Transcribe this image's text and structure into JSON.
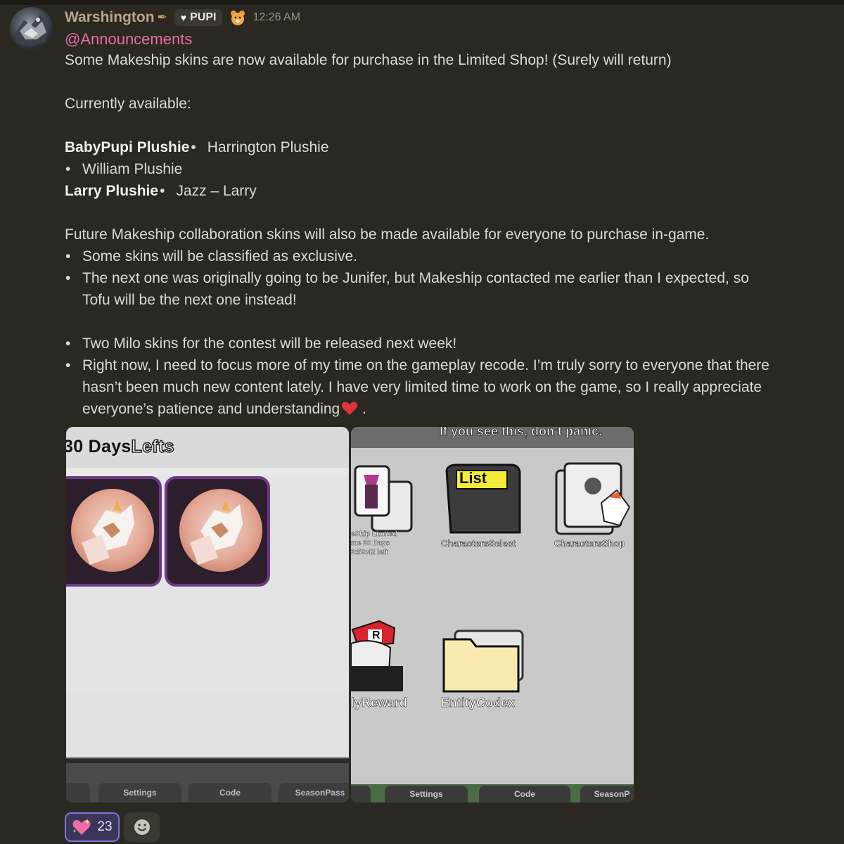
{
  "message": {
    "author": "Warshington",
    "author_icon": "quill-icon",
    "role_tag": "PUPI",
    "time": "12:26 AM",
    "mention": "@Announcements",
    "line1": "Some Makeship skins are now available for purchase in the Limited Shop! (Surely will return)",
    "currently": "Currently available:",
    "items": {
      "babypupi": "BabyPupi Plushie",
      "harrington": "Harrington Plushie",
      "william": "William Plushie",
      "larry": "Larry Plushie",
      "jazz": "Jazz – Larry"
    },
    "future": "Future Makeship collaboration skins will also be made available for everyone to purchase in-game.",
    "bullets": [
      "Some skins will be classified as exclusive.",
      "The next one was originally going to be Junifer, but Makeship contacted me earlier than I expected, so",
      "Tofu will be the next one instead!",
      "Two Milo skins for the contest will be released next week!",
      "Right now, I need to focus more of my time on the gameplay recode. I’m truly sorry to everyone that there",
      "hasn’t been much new content lately. I have very limited time to work on the game, so I really appreciate",
      "everyone’s patience and understanding"
    ],
    "trail": " ."
  },
  "image1": {
    "title_prefix": "30 Days",
    "title_suffix": "Lefts",
    "tabs": [
      "Settings",
      "Code",
      "SeasonPass"
    ]
  },
  "image2": {
    "caption": "If you see this, don’t panic.",
    "limited_lines": [
      "eShip Limited",
      "me 30 Days",
      "3:59:42 left"
    ],
    "list_label": "List",
    "characters_select": "CharactersSelect",
    "characters_shop": "CharactersShop",
    "daily_reward": "lyReward",
    "entity_codex": "EntityCodex",
    "tabs": [
      "Settings",
      "Code",
      "SeasonP"
    ]
  },
  "reactions": {
    "emoji": "sparkling-heart-icon",
    "count": "23"
  },
  "colors": {
    "background": "#2b2721",
    "mention": "#e26faa",
    "username": "#b9a48f",
    "reaction_border": "#7d76d8"
  }
}
